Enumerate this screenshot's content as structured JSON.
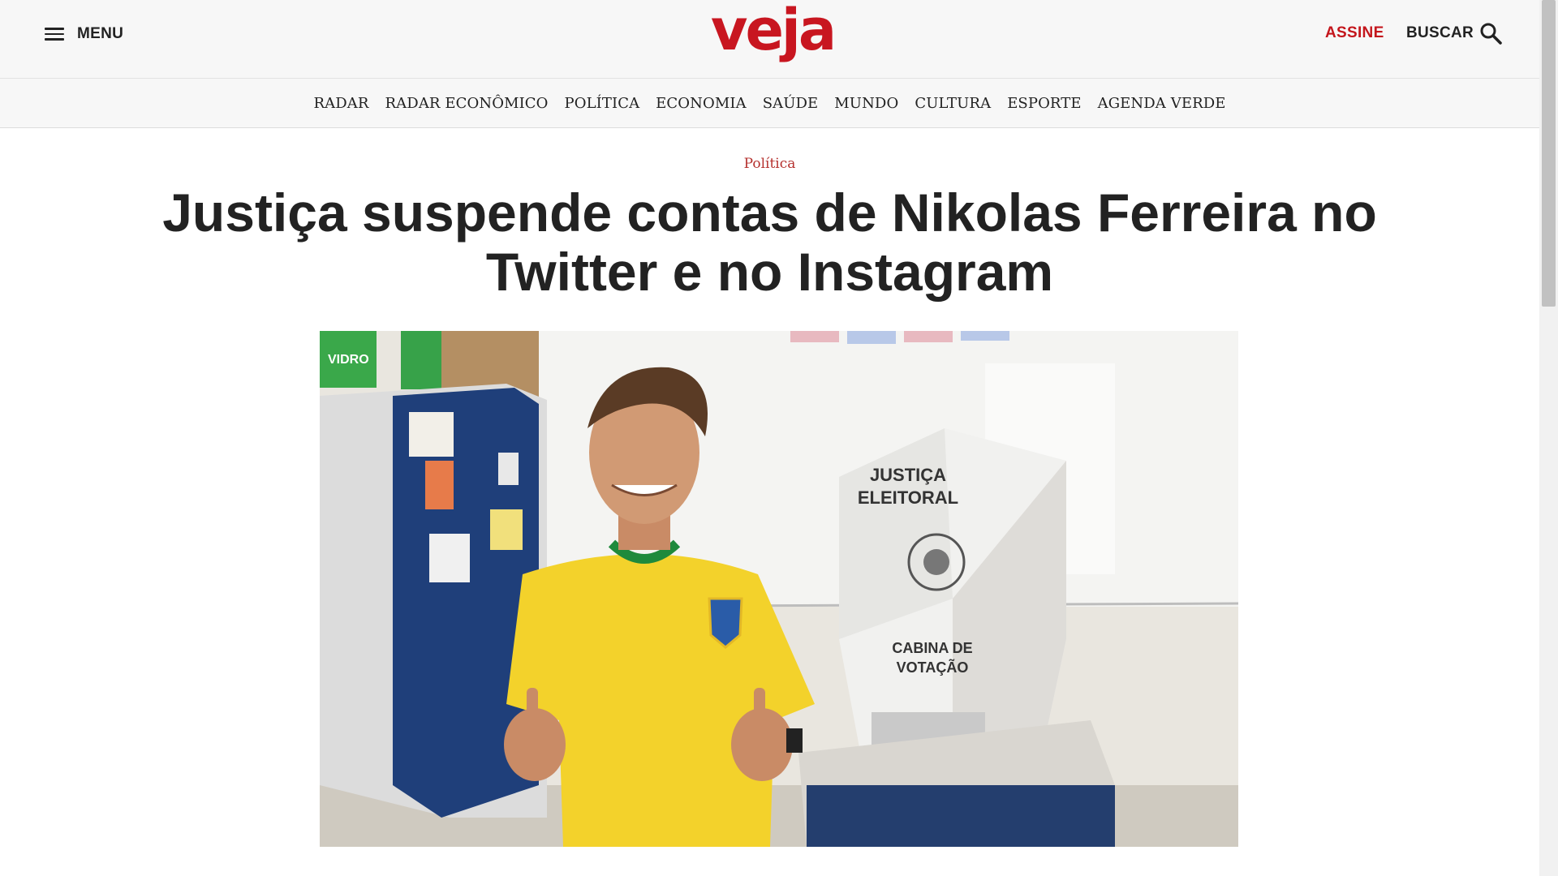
{
  "header": {
    "menu_label": "MENU",
    "logo_text": "veja",
    "subscribe_label": "ASSINE",
    "search_label": "BUSCAR",
    "brand_color": "#c81620",
    "icons": [
      "hamburger-icon",
      "search-icon"
    ]
  },
  "section_nav": {
    "items": [
      {
        "label": "RADAR"
      },
      {
        "label": "RADAR ECONÔMICO"
      },
      {
        "label": "POLÍTICA"
      },
      {
        "label": "ECONOMIA"
      },
      {
        "label": "SAÚDE"
      },
      {
        "label": "MUNDO"
      },
      {
        "label": "CULTURA"
      },
      {
        "label": "ESPORTE"
      },
      {
        "label": "AGENDA VERDE"
      }
    ]
  },
  "article": {
    "category": "Política",
    "headline": "Justiça suspende contas de Nikolas Ferreira no Twitter e no Instagram",
    "photo": {
      "booth_text_top_line1": "JUSTIÇA",
      "booth_text_top_line2": "ELEITORAL",
      "booth_text_bottom_line1": "CABINA DE",
      "booth_text_bottom_line2": "VOTAÇÃO",
      "bin_label": "VIDRO"
    }
  }
}
